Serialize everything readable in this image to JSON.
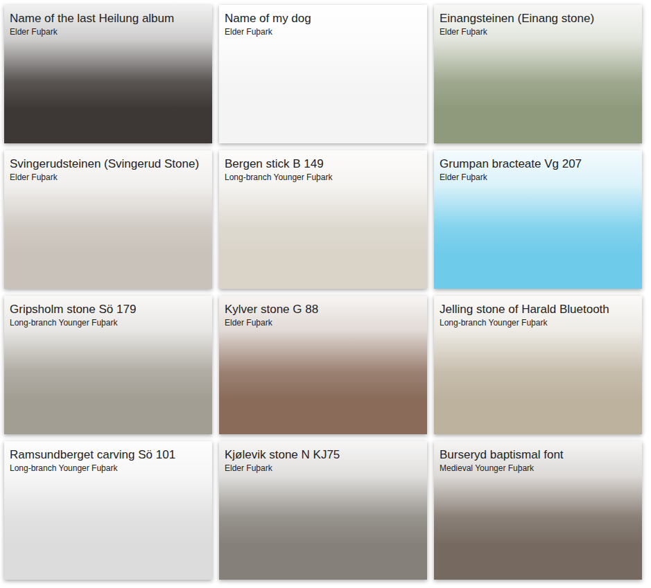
{
  "cards": [
    {
      "title": "Name of the last Heilung album",
      "script": "Elder Fuþark",
      "color": "#3d3836"
    },
    {
      "title": "Name of my dog",
      "script": "Elder Fuþark",
      "color": "#f4f4f4"
    },
    {
      "title": "Einangsteinen (Einang stone)",
      "script": "Elder Fuþark",
      "color": "#8f9a7c"
    },
    {
      "title": "Svingerudsteinen (Svingerud Stone)",
      "script": "Elder Fuþark",
      "color": "#c9c2ba"
    },
    {
      "title": "Bergen stick B 149",
      "script": "Long-branch Younger Fuþark",
      "color": "#d9d3c8"
    },
    {
      "title": "Grumpan bracteate Vg 207",
      "script": "Elder Fuþark",
      "color": "#6fcbea"
    },
    {
      "title": "Gripsholm stone Sö 179",
      "script": "Long-branch Younger Fuþark",
      "color": "#a39e94"
    },
    {
      "title": "Kylver stone G 88",
      "script": "Elder Fuþark",
      "color": "#8a6b5a"
    },
    {
      "title": "Jelling stone of Harald Bluetooth",
      "script": "Long-branch Younger Fuþark",
      "color": "#bdb29e"
    },
    {
      "title": "Ramsundberget carving Sö 101",
      "script": "Long-branch Younger Fuþark",
      "color": "#dcdcdc"
    },
    {
      "title": "Kjølevik stone N KJ75",
      "script": "Elder Fuþark",
      "color": "#858079"
    },
    {
      "title": "Burseryd baptismal font",
      "script": "Medieval Younger Fuþark",
      "color": "#766a60"
    }
  ]
}
